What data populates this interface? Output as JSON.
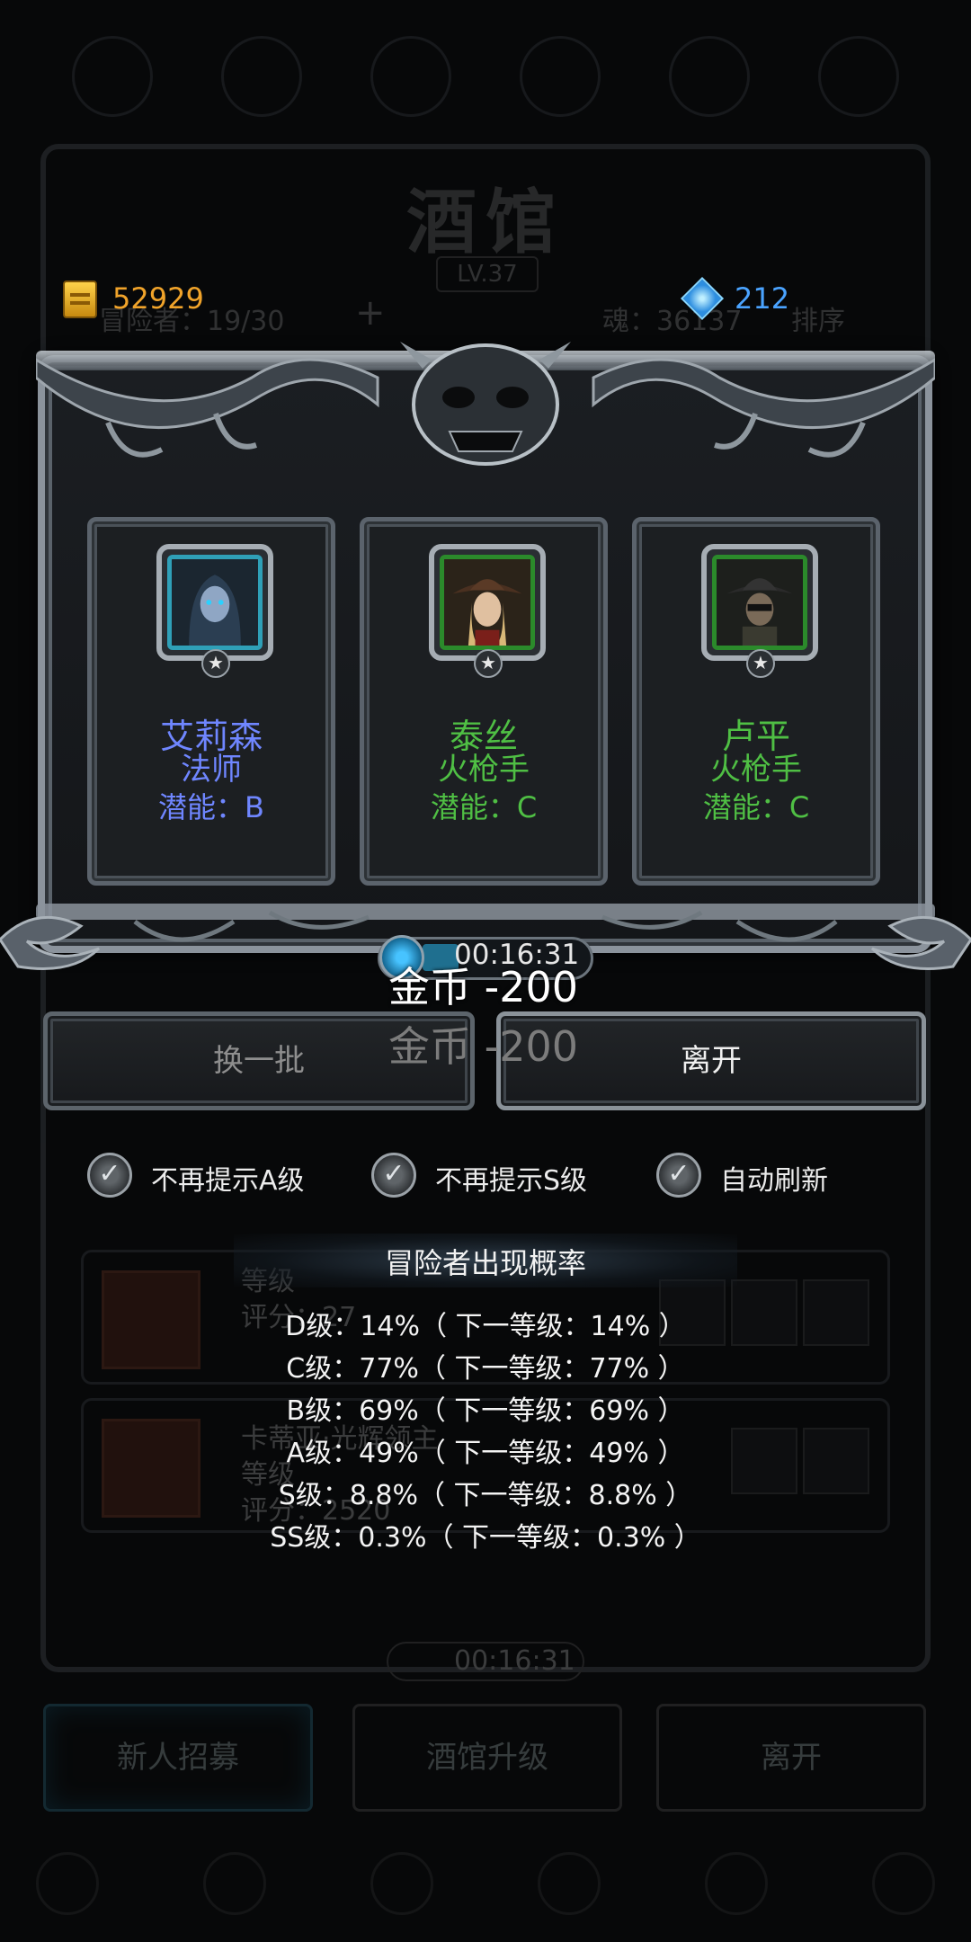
{
  "background": {
    "title": "酒馆",
    "level": "LV.37",
    "adventurers": "冒险者：19/30",
    "plus": "+",
    "soul": "魂：36137",
    "sort": "排序",
    "row1_name": "等级",
    "row1_stat1": "评分：27",
    "row2_name": "卡蒂亚·光辉领主",
    "row2_stat1": "等级",
    "row2_stat2": "评分：2520",
    "timer": "00:16:31",
    "buttons": [
      "新人招募",
      "酒馆升级",
      "离开"
    ]
  },
  "currency": {
    "gold": "52929",
    "gems": "212"
  },
  "recruits": [
    {
      "name": "艾莉森",
      "class": "法师",
      "potential": "潜能：B",
      "color": "#6f86ff",
      "frame": "blue",
      "star": "★"
    },
    {
      "name": "泰丝",
      "class": "火枪手",
      "potential": "潜能：C",
      "color": "#4fbf44",
      "frame": "green",
      "star": "★"
    },
    {
      "name": "卢平",
      "class": "火枪手",
      "potential": "潜能：C",
      "color": "#4fbf44",
      "frame": "green",
      "star": "★"
    }
  ],
  "timer": "00:16:31",
  "gold_cost_popup": [
    "金币 -200",
    "金币 -200"
  ],
  "buttons": {
    "refresh": "换一批",
    "leave": "离开"
  },
  "options": [
    {
      "label": "不再提示A级",
      "icon": "check-icon",
      "checked": true
    },
    {
      "label": "不再提示S级",
      "icon": "check-icon",
      "checked": true
    },
    {
      "label": "自动刷新",
      "icon": "check-icon",
      "checked": true
    }
  ],
  "probability": {
    "title": "冒险者出现概率",
    "lines": [
      "D级：14%（ 下一等级：14% ）",
      "C级：77%（ 下一等级：77% ）",
      "B级：69%（ 下一等级：69% ）",
      "A级：49%（ 下一等级：49% ）",
      "S级：8.8%（ 下一等级：8.8% ）",
      "SS级：0.3%（ 下一等级：0.3% ）"
    ]
  }
}
